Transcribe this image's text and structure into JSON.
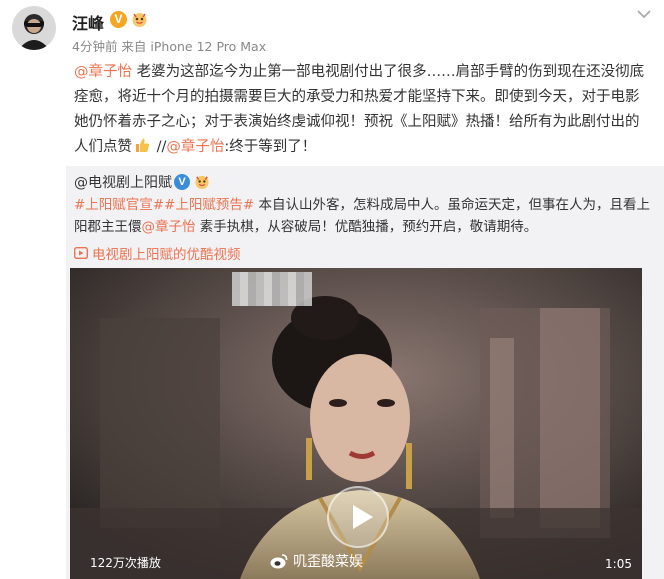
{
  "post": {
    "author": "汪峰",
    "meta": "4分钟前 来自 iPhone 12 Pro Max",
    "text_mention": "@章子怡",
    "text_body": " 老婆为这部迄今为止第一部电视剧付出了很多……肩部手臂的伤到现在还没彻底痊愈，将近十个月的拍摄需要巨大的承受力和热爱才能坚持下来。即使到今天，对于电影她仍怀着赤子之心；对于表演始终虔诚仰视！预祝《上阳赋》热播！给所有为此剧付出的人们点赞",
    "text_sep": " //",
    "text_mention2": "@章子怡",
    "text_tail": ":终于等到了！",
    "verified_icon": "v-verified-icon",
    "fan_badge_icon": "fan-badge-icon",
    "thumb_icon": "thumbs-up-icon"
  },
  "repost": {
    "author": "@电视剧上阳赋",
    "hashtag1": "#上阳赋官宣#",
    "hashtag2": "#上阳赋预告#",
    "text1": " 本自认山外客，怎料成局中人。虽命运天定，但事在人为，且看上阳郡主王儇",
    "mention": "@章子怡",
    "text2": " 素手执棋，从容破局！优酷独播，预约开启，敬请期待。",
    "video_link": "电视剧上阳赋的优酷视频",
    "video": {
      "plays": "122万次播放",
      "duration": "1:05",
      "watermark": "叽歪酸菜娱"
    }
  },
  "colors": {
    "link": "#eb7350",
    "repost_bg": "#f2f2f5",
    "verified_gold": "#f5a623",
    "verified_blue": "#3d8bdb"
  }
}
